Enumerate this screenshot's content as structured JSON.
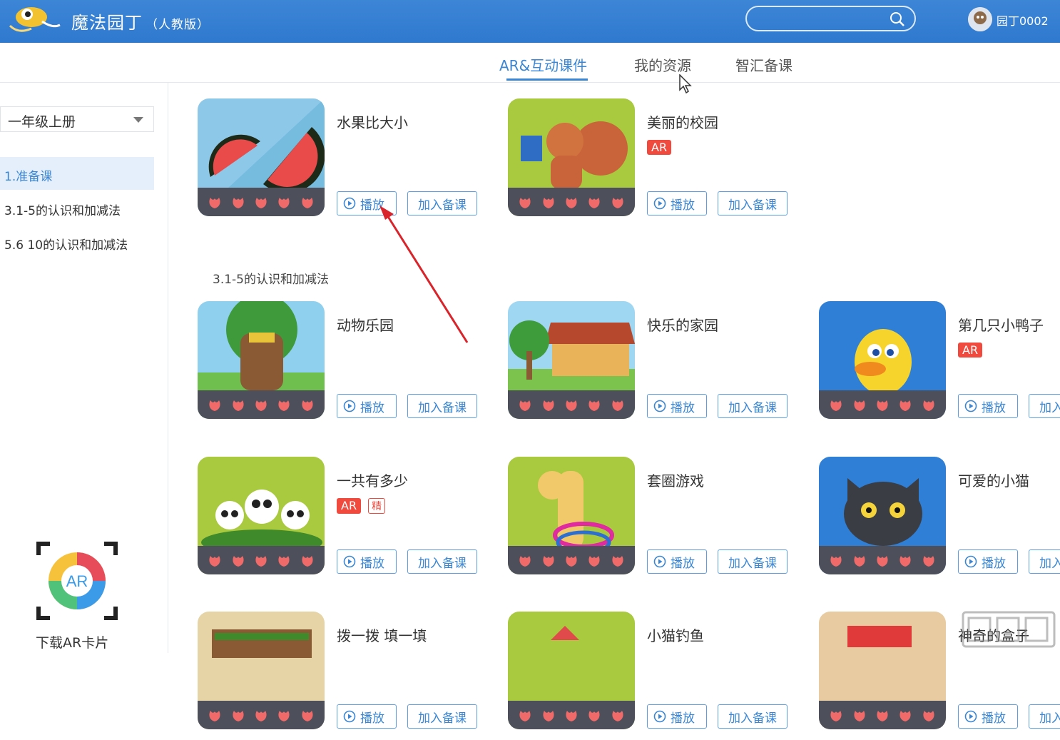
{
  "header": {
    "app_title": "魔法园丁",
    "app_subtitle": "（人教版）",
    "search_placeholder": "",
    "username": "园丁0002"
  },
  "tabs": [
    {
      "label": "AR&互动课件",
      "active": true
    },
    {
      "label": "我的资源",
      "active": false
    },
    {
      "label": "智汇备课",
      "active": false
    }
  ],
  "sidebar": {
    "grade_select": "一年级上册",
    "items": [
      {
        "label": "1.准备课",
        "active": true
      },
      {
        "label": "3.1-5的认识和加减法",
        "active": false
      },
      {
        "label": "5.6  10的认识和加减法",
        "active": false
      }
    ],
    "ar_card_label": "下载AR卡片"
  },
  "buttons": {
    "play": "播放",
    "add": "加入备课"
  },
  "badges": {
    "ar": "AR",
    "jing": "精"
  },
  "sections": {
    "section2_title": "3.1-5的认识和加减法"
  },
  "cards": [
    {
      "title": "水果比大小",
      "ar": false,
      "jing": false,
      "theme": "watermelon"
    },
    {
      "title": "美丽的校园",
      "ar": true,
      "jing": false,
      "theme": "squirrel"
    },
    {
      "title": "动物乐园",
      "ar": false,
      "jing": false,
      "theme": "tree"
    },
    {
      "title": "快乐的家园",
      "ar": false,
      "jing": false,
      "theme": "house"
    },
    {
      "title": "第几只小鸭子",
      "ar": true,
      "jing": false,
      "theme": "duck"
    },
    {
      "title": "一共有多少",
      "ar": true,
      "jing": true,
      "theme": "pandas"
    },
    {
      "title": "套圈游戏",
      "ar": false,
      "jing": false,
      "theme": "giraffe"
    },
    {
      "title": "可爱的小猫",
      "ar": false,
      "jing": false,
      "theme": "cat"
    },
    {
      "title": "拨一拨 填一填",
      "ar": false,
      "jing": false,
      "theme": "abacus"
    },
    {
      "title": "小猫钓鱼",
      "ar": false,
      "jing": false,
      "theme": "fishing"
    },
    {
      "title": "神奇的盒子",
      "ar": false,
      "jing": false,
      "theme": "box"
    }
  ],
  "colors": {
    "header_blue": "#2f79cf",
    "accent": "#3a86d4",
    "ar_red": "#f04a3e"
  }
}
